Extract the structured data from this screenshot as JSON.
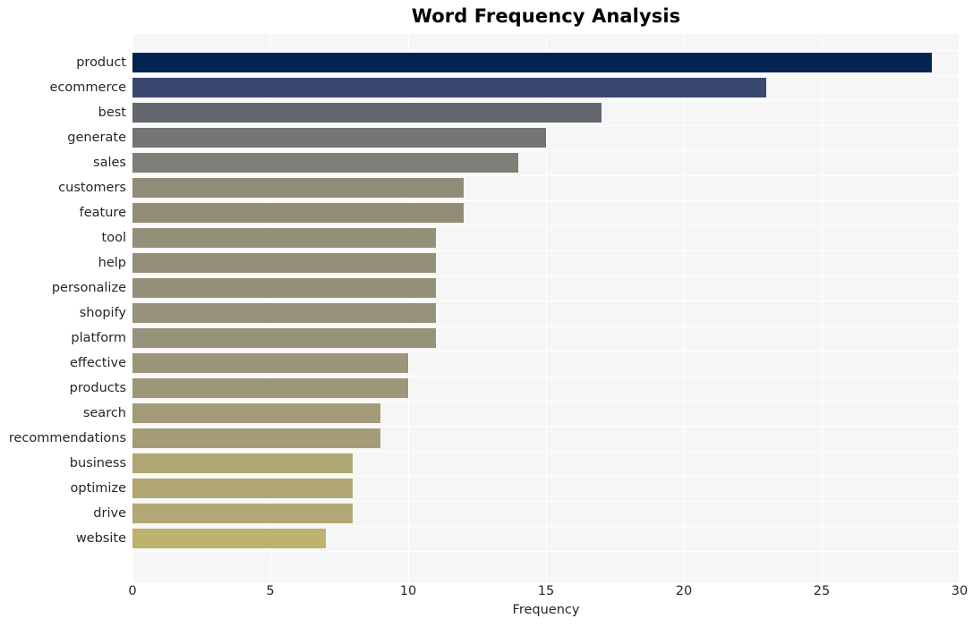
{
  "chart_data": {
    "type": "bar",
    "orientation": "horizontal",
    "title": "Word Frequency Analysis",
    "xlabel": "Frequency",
    "ylabel": "",
    "xlim": [
      0,
      30
    ],
    "ylim": [
      0,
      20
    ],
    "xticks": [
      0,
      5,
      10,
      15,
      20,
      25,
      30
    ],
    "xtick_labels": [
      "0",
      "5",
      "10",
      "15",
      "20",
      "25",
      "30"
    ],
    "grid": true,
    "grid_axis": "both",
    "legend": null,
    "categories": [
      "product",
      "ecommerce",
      "best",
      "generate",
      "sales",
      "customers",
      "feature",
      "tool",
      "help",
      "personalize",
      "shopify",
      "platform",
      "effective",
      "products",
      "search",
      "recommendations",
      "business",
      "optimize",
      "drive",
      "website"
    ],
    "values": [
      29,
      23,
      17,
      15,
      14,
      12,
      12,
      11,
      11,
      11,
      11,
      11,
      10,
      10,
      9,
      9,
      8,
      8,
      8,
      7
    ],
    "bar_colors": [
      "#032352",
      "#3a4770",
      "#65676e",
      "#737474",
      "#7e7e76",
      "#908c77",
      "#918d77",
      "#938f78",
      "#948f78",
      "#95907a",
      "#96917a",
      "#97927b",
      "#9b9579",
      "#9d9779",
      "#a39b77",
      "#a49c77",
      "#afa673",
      "#b0a773",
      "#b1a873",
      "#bdb26e"
    ],
    "plot_background": "#f6f6f7",
    "figure_background": "#ffffff",
    "tick_color": "#262626",
    "title_color": "#000000"
  }
}
